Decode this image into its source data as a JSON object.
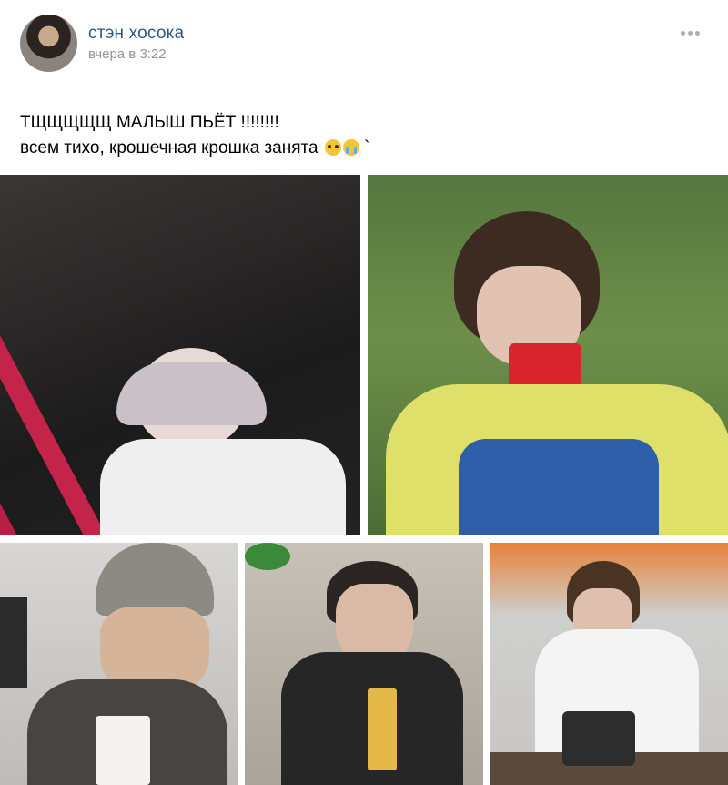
{
  "post": {
    "author": "стэн хосока",
    "time": "вчера в 3:22",
    "text_line1": "ТЩЩЩЩЩ МАЛЫШ ПЬЁТ !!!!!!!!",
    "text_line2": "всем тихо, крошечная крошка занята",
    "text_trailing": " `",
    "emojis": [
      "pleading-face-icon",
      "loudly-crying-face-icon"
    ]
  },
  "photos": [
    {
      "id": "photo-1",
      "description": "person drinking through straw"
    },
    {
      "id": "photo-2",
      "description": "person drinking from red cup"
    },
    {
      "id": "photo-3",
      "description": "person in beanie drinking"
    },
    {
      "id": "photo-4",
      "description": "person drinking with straw from glass"
    },
    {
      "id": "photo-5",
      "description": "person drinking at table"
    }
  ],
  "colors": {
    "author_link": "#2a5885",
    "timestamp": "#939393",
    "menu_dots": "#a8b0b8"
  }
}
